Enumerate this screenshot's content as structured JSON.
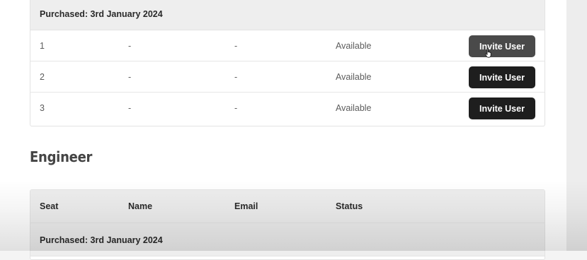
{
  "first_group": {
    "purchased_label": "Purchased: 3rd January 2024",
    "rows": [
      {
        "seat": "1",
        "name": "-",
        "email": "-",
        "status": "Available",
        "action": "Invite User"
      },
      {
        "seat": "2",
        "name": "-",
        "email": "-",
        "status": "Available",
        "action": "Invite User"
      },
      {
        "seat": "3",
        "name": "-",
        "email": "-",
        "status": "Available",
        "action": "Invite User"
      }
    ]
  },
  "engineer_section": {
    "title": "Engineer",
    "columns": [
      "Seat",
      "Name",
      "Email",
      "Status"
    ],
    "purchased_label": "Purchased: 3rd January 2024"
  },
  "colors": {
    "button_bg": "#1e1e1e",
    "button_hover_bg": "#4a4a4a",
    "header_bg": "#eeeeee"
  },
  "icons": {
    "cursor": "hand-pointer-icon"
  }
}
